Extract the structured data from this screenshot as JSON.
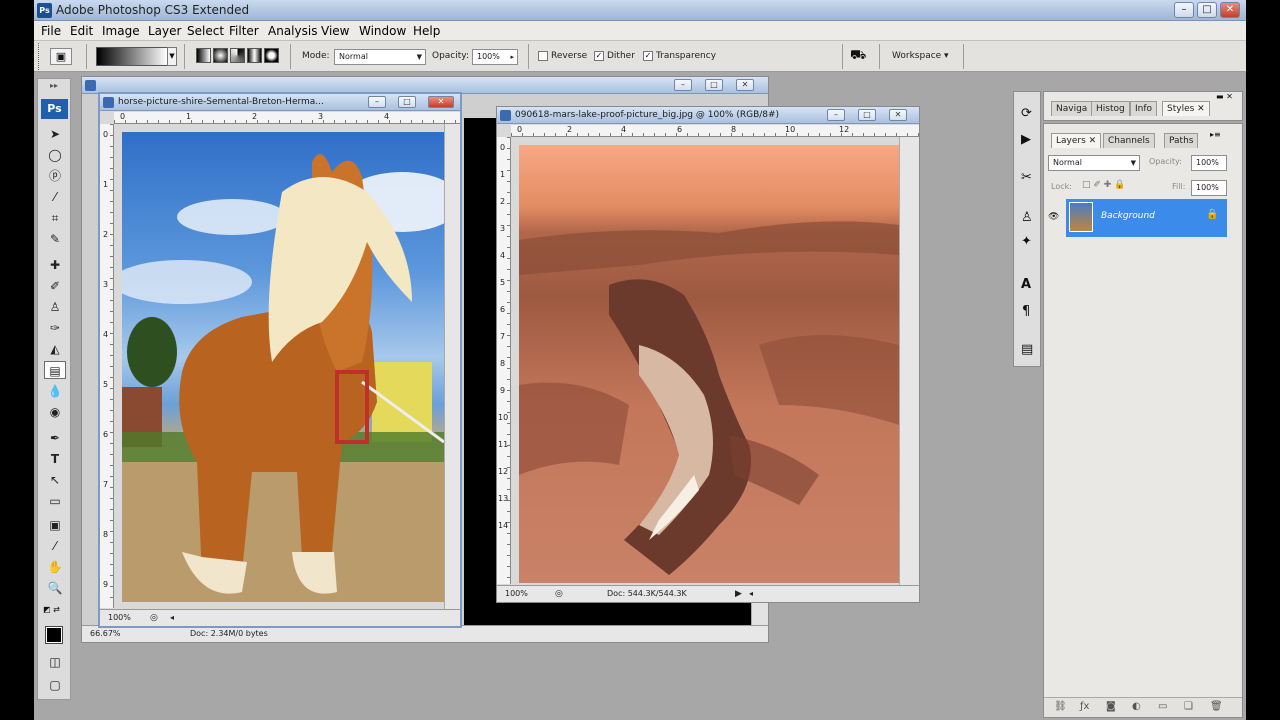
{
  "app": {
    "title": "Adobe Photoshop CS3 Extended",
    "window_controls": {
      "minimize": "–",
      "maximize": "□",
      "close": "✕"
    }
  },
  "menu": [
    "File",
    "Edit",
    "Image",
    "Layer",
    "Select",
    "Filter",
    "Analysis",
    "View",
    "Window",
    "Help"
  ],
  "options": {
    "mode_label": "Mode:",
    "mode_value": "Normal",
    "opacity_label": "Opacity:",
    "opacity_value": "100%",
    "reverse_label": "Reverse",
    "dither_label": "Dither",
    "transparency_label": "Transparency",
    "workspace_label": "Workspace ▾"
  },
  "toolbox": {
    "logo": "Ps",
    "tools": [
      "move-tool",
      "marquee-tool",
      "lasso-tool",
      "magic-wand-tool",
      "crop-tool",
      "slice-tool",
      "healing-brush-tool",
      "brush-tool",
      "clone-stamp-tool",
      "history-brush-tool",
      "eraser-tool",
      "gradient-tool",
      "blur-tool",
      "dodge-tool",
      "pen-tool",
      "type-tool",
      "path-selection-tool",
      "shape-tool",
      "notes-tool",
      "eyedropper-tool",
      "hand-tool",
      "zoom-tool"
    ]
  },
  "doc_back": {
    "zoom": "66.67%",
    "docsize": "Doc: 2.34M/0 bytes"
  },
  "doc_horse": {
    "title": "horse-picture-shire-Semental-Breton-Herma...",
    "zoom": "100%",
    "ruler_h": [
      "0",
      "1",
      "2",
      "3",
      "4"
    ],
    "ruler_v": [
      "0",
      "1",
      "2",
      "3",
      "4",
      "5",
      "6",
      "7",
      "8",
      "9"
    ]
  },
  "doc_mars": {
    "title": "090618-mars-lake-proof-picture_big.jpg @ 100% (RGB/8#)",
    "zoom": "100%",
    "docsize": "Doc: 544.3K/544.3K",
    "ruler_h": [
      "0",
      "2",
      "4",
      "6",
      "8",
      "10",
      "12"
    ],
    "ruler_v": [
      "0",
      "1",
      "2",
      "3",
      "4",
      "5",
      "6",
      "7",
      "8",
      "9",
      "10",
      "11",
      "12",
      "13",
      "14"
    ]
  },
  "panel_top": {
    "tabs": [
      "Naviga",
      "Histog",
      "Info",
      "Styles"
    ]
  },
  "layers_panel": {
    "tabs": [
      "Layers",
      "Channels",
      "Paths"
    ],
    "blend_mode": "Normal",
    "opacity_label": "Opacity:",
    "opacity_value": "100%",
    "lock_label": "Lock:",
    "fill_label": "Fill:",
    "fill_value": "100%",
    "layer_name": "Background"
  },
  "colors": {
    "accent": "#3b8bea",
    "titlebar": "#a9c0de",
    "workspace": "#a7a7a7"
  }
}
